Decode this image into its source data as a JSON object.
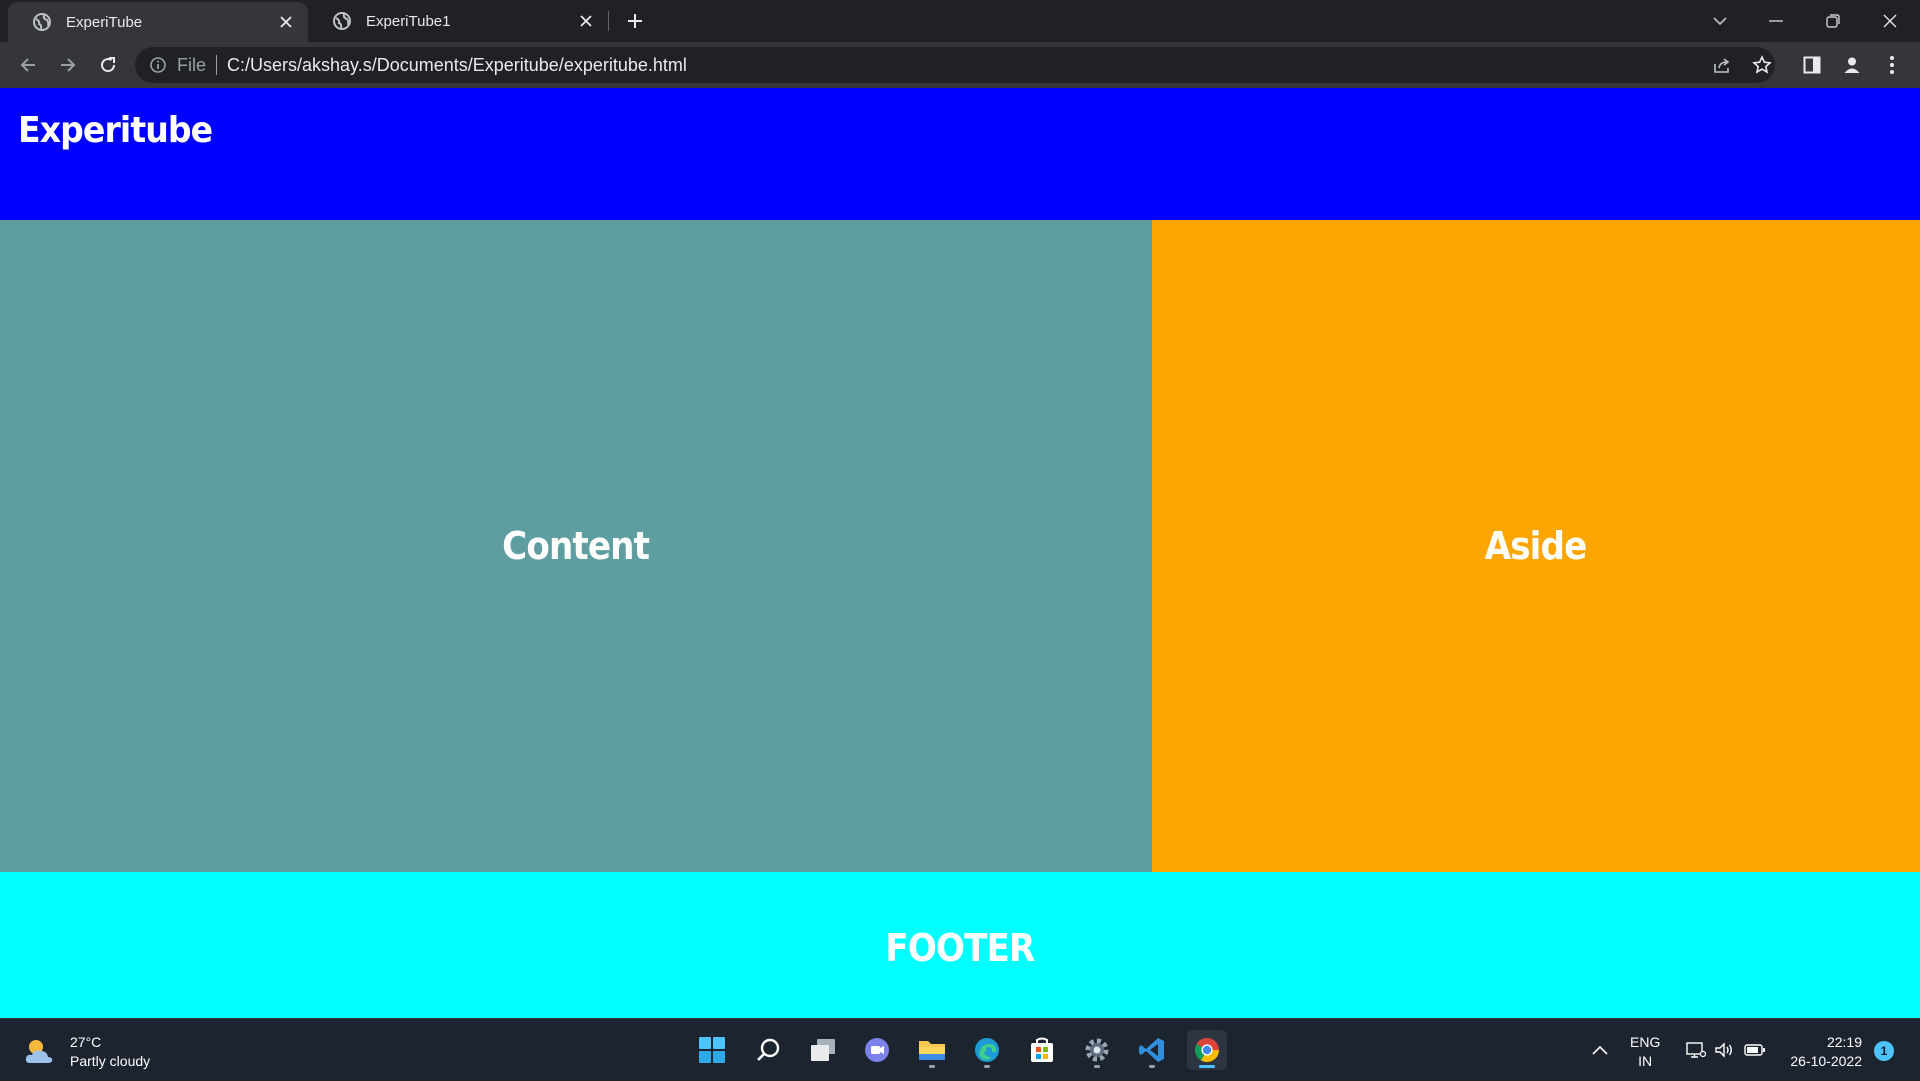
{
  "browser": {
    "tabs": [
      {
        "title": "ExperiTube",
        "active": true
      },
      {
        "title": "ExperiTube1",
        "active": false
      }
    ],
    "address": {
      "scheme_label": "File",
      "url": "C:/Users/akshay.s/Documents/Experitube/experitube.html"
    }
  },
  "page": {
    "header_title": "Experitube",
    "content_label": "Content",
    "aside_label": "Aside",
    "footer_label": "FOOTER",
    "colors": {
      "header": "#0000ff",
      "content": "#5f9ea0",
      "aside": "#ffa500",
      "footer": "#00ffff",
      "text": "#ffffff"
    }
  },
  "taskbar": {
    "weather": {
      "temp": "27°C",
      "condition": "Partly cloudy",
      "icon": "partly-cloudy-icon"
    },
    "apps": [
      "windows-start-icon",
      "search-icon",
      "task-view-icon",
      "teams-chat-icon",
      "file-explorer-icon",
      "edge-icon",
      "store-icon",
      "settings-icon",
      "vscode-icon",
      "chrome-icon"
    ],
    "lang": {
      "line1": "ENG",
      "line2": "IN"
    },
    "clock": {
      "time": "22:19",
      "date": "26-10-2022"
    },
    "notifications": "1"
  }
}
